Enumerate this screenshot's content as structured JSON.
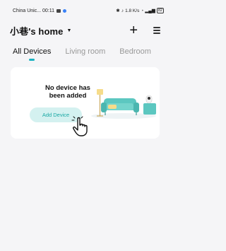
{
  "status_bar": {
    "carrier": "China Unic... 00:11",
    "indicators": "1.8 K/s",
    "battery": "82"
  },
  "header": {
    "home_title": "小巷's home",
    "caret": "▼",
    "add_icon": "+"
  },
  "tabs": [
    {
      "label": "All Devices",
      "active": true
    },
    {
      "label": "Living room",
      "active": false
    },
    {
      "label": "Bedroom",
      "active": false
    }
  ],
  "empty_state": {
    "message_line1": "No device has",
    "message_line2": "been added",
    "button_label": "Add Device"
  },
  "colors": {
    "accent": "#19b2c1",
    "button_bg": "#d4f1f0",
    "button_text": "#1aa8a4",
    "background": "#f5f5f7"
  }
}
